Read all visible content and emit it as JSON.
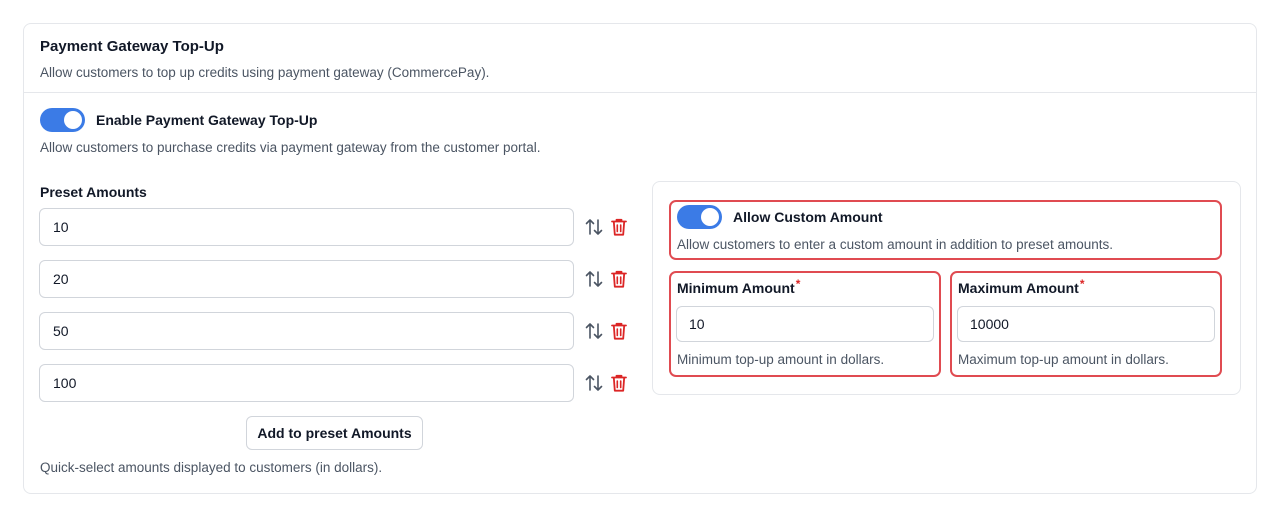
{
  "section": {
    "title": "Payment Gateway Top-Up",
    "description": "Allow customers to top up credits using payment gateway (CommercePay)."
  },
  "enable_toggle": {
    "label": "Enable Payment Gateway Top-Up",
    "description": "Allow customers to purchase credits via payment gateway from the customer portal.",
    "checked": true
  },
  "preset": {
    "heading": "Preset Amounts",
    "amounts": [
      "10",
      "20",
      "50",
      "100"
    ],
    "add_button_label": "Add to preset Amounts",
    "help": "Quick-select amounts displayed to customers (in dollars)."
  },
  "custom_amount": {
    "label": "Allow Custom Amount",
    "description": "Allow customers to enter a custom amount in addition to preset amounts.",
    "checked": true,
    "min": {
      "label": "Minimum Amount",
      "required_mark": "*",
      "value": "10",
      "help": "Minimum top-up amount in dollars."
    },
    "max": {
      "label": "Maximum Amount",
      "required_mark": "*",
      "value": "10000",
      "help": "Maximum top-up amount in dollars."
    }
  },
  "icons": {
    "sort": "sort-arrows-icon",
    "delete": "trash-icon"
  },
  "colors": {
    "toggle_on": "#3b7be6",
    "delete_icon": "#dc2626",
    "highlight": "#e04b51"
  }
}
